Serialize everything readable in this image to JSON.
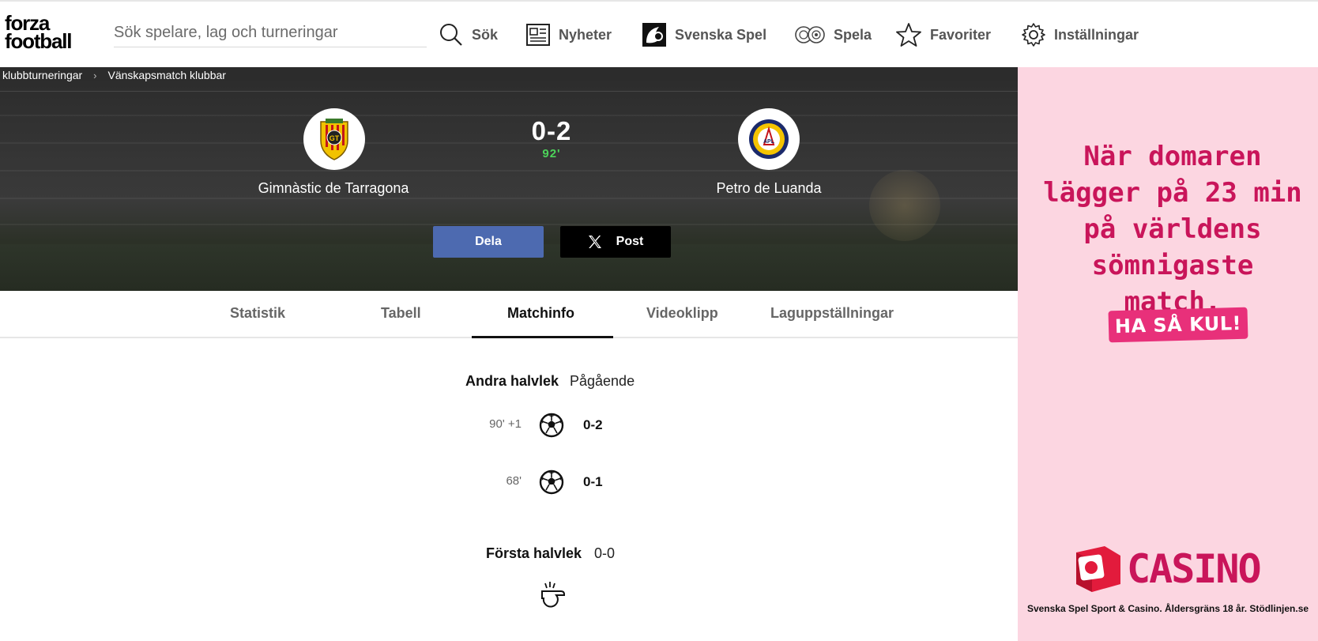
{
  "header": {
    "logo_line1": "forza",
    "logo_line2": "football",
    "search_placeholder": "Sök spelare, lag och turneringar",
    "nav": [
      {
        "label": "Sök",
        "icon": "search-icon"
      },
      {
        "label": "Nyheter",
        "icon": "news-icon"
      },
      {
        "label": "Svenska Spel",
        "icon": "svenska-spel-icon"
      },
      {
        "label": "Spela",
        "icon": "chips-icon"
      },
      {
        "label": "Favoriter",
        "icon": "star-icon"
      },
      {
        "label": "Inställningar",
        "icon": "gear-icon"
      }
    ]
  },
  "breadcrumb": {
    "items": [
      "klubbturneringar",
      "Vänskapsmatch klubbar"
    ],
    "separator": "›"
  },
  "match": {
    "home_team": "Gimnàstic de Tarragona",
    "away_team": "Petro de Luanda",
    "score": "0-2",
    "minute": "92'",
    "share_label": "Dela",
    "post_label": "Post"
  },
  "tabs": [
    {
      "label": "Statistik",
      "active": false
    },
    {
      "label": "Tabell",
      "active": false
    },
    {
      "label": "Matchinfo",
      "active": true
    },
    {
      "label": "Videoklipp",
      "active": false
    },
    {
      "label": "Laguppställningar",
      "active": false
    }
  ],
  "matchinfo": {
    "second_half": {
      "title": "Andra halvlek",
      "status": "Pågående",
      "events": [
        {
          "minute": "90' +1",
          "score": "0-2",
          "icon": "football-icon"
        },
        {
          "minute": "68'",
          "score": "0-1",
          "icon": "football-icon"
        }
      ]
    },
    "first_half": {
      "title": "Första halvlek",
      "score": "0-0",
      "icon": "whistle-icon"
    }
  },
  "ad": {
    "headline": "När domaren lägger på 23 min på världens sömnigaste match.",
    "cta": "HA SÅ KUL!",
    "brand": "CASINO",
    "legal": "Svenska Spel Sport & Casino. Åldersgräns 18 år. Stödlinjen.se"
  },
  "colors": {
    "accent_share": "#4d6ab0",
    "minute_green": "#4cd35a",
    "ad_background": "#fcd6e1",
    "ad_pink": "#c9155a"
  }
}
